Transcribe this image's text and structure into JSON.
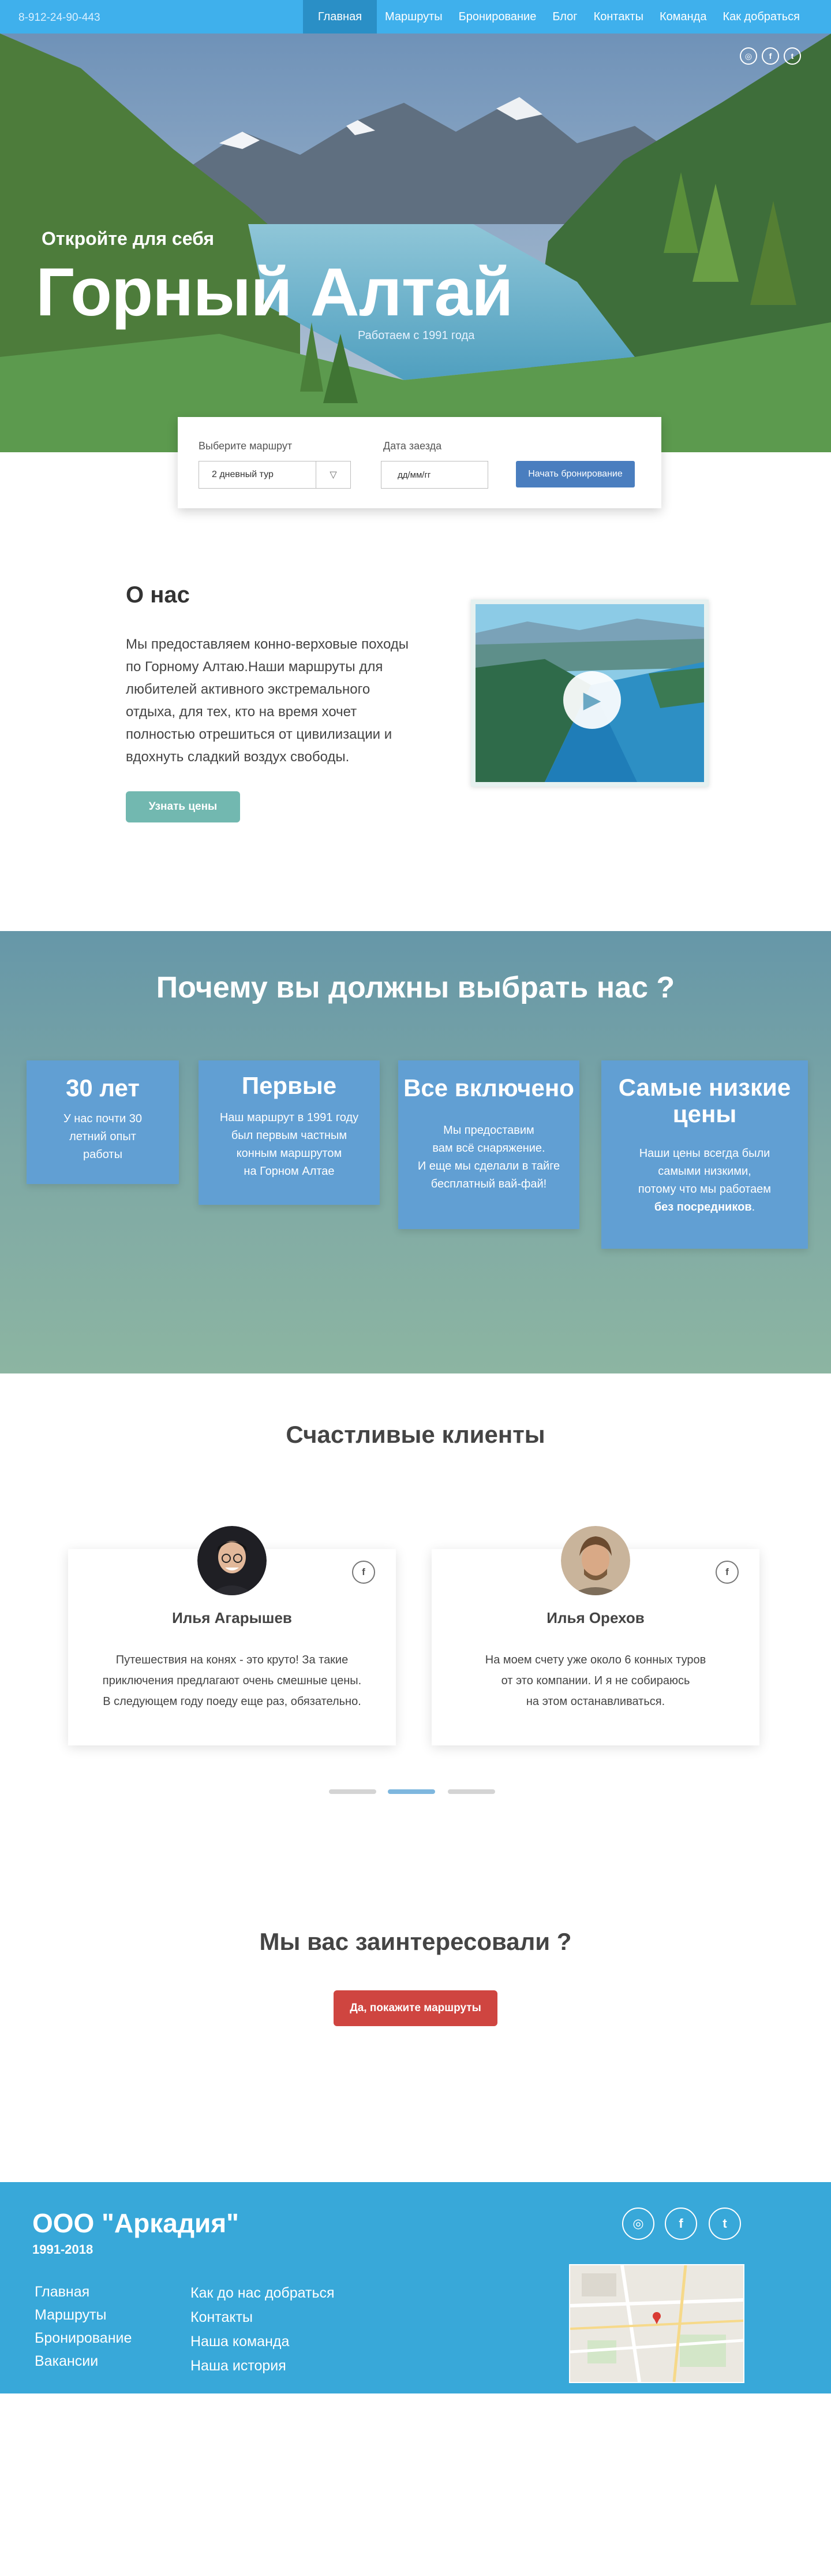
{
  "topbar": {
    "phone": "8-912-24-90-443",
    "nav": [
      "Главная",
      "Маршруты",
      "Бронирование",
      "Блог",
      "Контакты",
      "Команда",
      "Как добраться"
    ]
  },
  "hero": {
    "subtitle": "Откройте для себя",
    "title": "Горный Алтай",
    "since": "Работаем с 1991 года",
    "social_icons": [
      "instagram-icon",
      "facebook-icon",
      "twitter-icon"
    ]
  },
  "booking": {
    "route_label": "Выберите маршрут",
    "route_value": "2 дневный тур",
    "date_label": "Дата заезда",
    "date_placeholder": "дд/мм/гг",
    "submit_label": "Начать бронирование"
  },
  "about": {
    "title": "О нас",
    "text": "Мы предоставляем конно-верховые походы по  Горному Алтаю.Наши маршруты для любителей активного экстремального отдыха, для тех, кто на время хочет полностью отрешиться от цивилизации и вдохнуть сладкий воздух свободы.",
    "button": "Узнать цены"
  },
  "why": {
    "title": "Почему вы должны выбрать нас ?",
    "cards": [
      {
        "heading": "30 лет",
        "lines": [
          "У нас  почти 30",
          "летний опыт",
          "работы"
        ]
      },
      {
        "heading": "Первые",
        "lines": [
          "Наш маршрут в 1991 году",
          "был первым частным",
          "конным маршрутом",
          "на Горном Алтае"
        ]
      },
      {
        "heading": "Все включено",
        "lines": [
          "Мы предоставим",
          "вам всё снаряжение.",
          "И еще мы сделали в тайге",
          "бесплатный вай-фай!"
        ]
      },
      {
        "heading_lines": [
          "Самые низкие",
          "цены"
        ],
        "lines": [
          "Наши цены всегда были",
          "самыми низкими,",
          "потому что мы работаем"
        ],
        "bold_line": "без посредников",
        "bold_suffix": "."
      }
    ]
  },
  "clients": {
    "title": "Счастливые клиенты",
    "reviews": [
      {
        "name": "Илья Агарышев",
        "lines": [
          "Путешествия на конях - это круто! За такие",
          "приключения предлагают очень смешные цены.",
          "В следующем году поеду еще раз, обязательно."
        ]
      },
      {
        "name": "Илья Орехов",
        "lines": [
          "На моем счету уже около 6 конных туров",
          "от это компании. И я не собираюсь",
          "на этом останавливаться."
        ]
      }
    ],
    "carousel": {
      "pages": 3,
      "active": 2
    }
  },
  "cta": {
    "title": "Мы вас заинтересовали ?",
    "button": "Да, покажите маршруты"
  },
  "footer": {
    "company": "ООО \"Аркадия\"",
    "years": "1991-2018",
    "links_left": [
      "Главная",
      "Маршруты",
      "Бронирование",
      "Вакансии"
    ],
    "links_right": [
      "Как до нас добраться",
      "Контакты",
      "Наша команда",
      "Наша история"
    ],
    "social_icons": [
      "instagram-icon",
      "facebook-icon",
      "twitter-icon"
    ]
  },
  "colors": {
    "nav_bg": "#3fb0ec",
    "nav_active": "#2a8fc6",
    "booking_button": "#4a7ebf",
    "about_button": "#72b8b0",
    "card_bg": "#619fd3",
    "cta_button": "#cf4540",
    "footer_bg": "#38a8d9"
  }
}
